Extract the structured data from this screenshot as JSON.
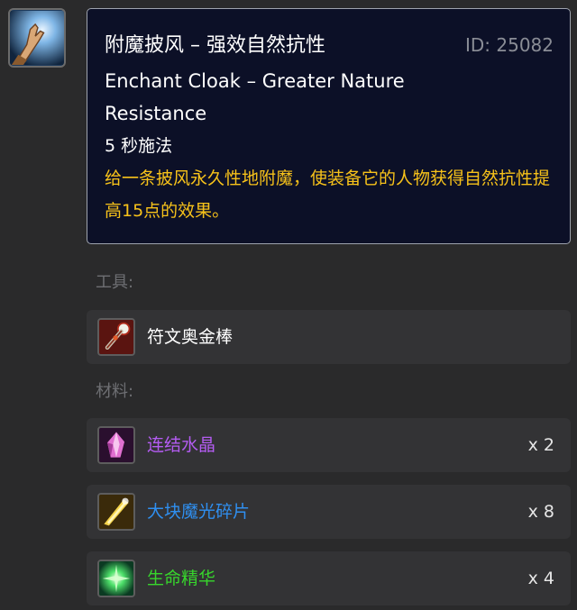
{
  "spell": {
    "icon": "enchanting-hand-icon",
    "title": "附魔披风 – 强效自然抗性",
    "id_label": "ID: 25082",
    "name_en": "Enchant Cloak – Greater Nature Resistance",
    "cast_time": "5 秒施法",
    "description": "给一条披风永久性地附魔，使装备它的人物获得自然抗性提高15点的效果。"
  },
  "tools": {
    "label": "工具:",
    "items": [
      {
        "name": "符文奥金棒",
        "icon": "runed-adamantite-rod-icon",
        "color": "#ffffff"
      }
    ]
  },
  "materials": {
    "label": "材料:",
    "items": [
      {
        "name": "连结水晶",
        "quantity": "x 2",
        "icon": "nexus-crystal-icon",
        "color": "#b45cf2"
      },
      {
        "name": "大块魔光碎片",
        "quantity": "x 8",
        "icon": "large-prismatic-shard-icon",
        "color": "#2f8ff0"
      },
      {
        "name": "生命精华",
        "quantity": "x 4",
        "icon": "essence-of-life-icon",
        "color": "#37d62c"
      }
    ]
  },
  "colors": {
    "background": "#2a2a2b",
    "tooltip_bg": "#0c1027",
    "description": "#f7c21a",
    "id": "#8a8d96"
  }
}
